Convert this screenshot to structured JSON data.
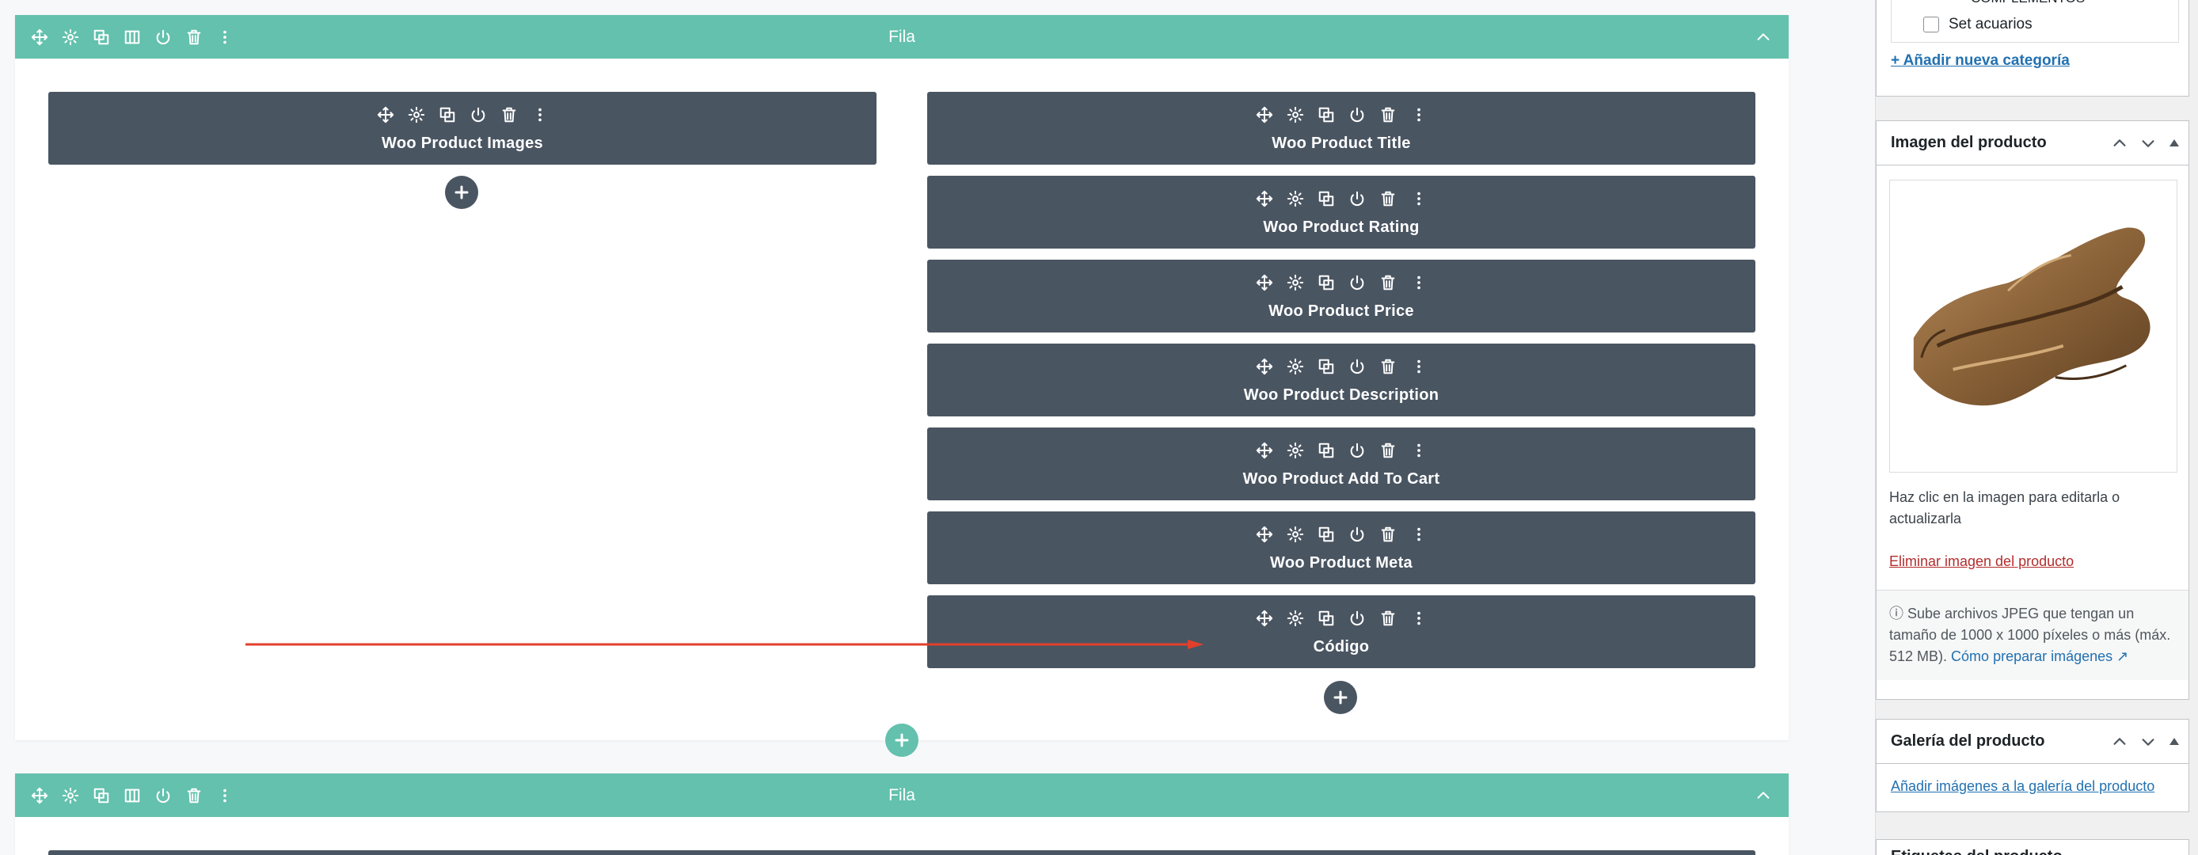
{
  "rows": [
    {
      "title": "Fila"
    },
    {
      "title": "Fila"
    }
  ],
  "left_column": {
    "modules": [
      {
        "title": "Woo Product Images"
      }
    ]
  },
  "right_column": {
    "modules": [
      {
        "title": "Woo Product Title"
      },
      {
        "title": "Woo Product Rating"
      },
      {
        "title": "Woo Product Price"
      },
      {
        "title": "Woo Product Description"
      },
      {
        "title": "Woo Product Add To Cart"
      },
      {
        "title": "Woo Product Meta"
      },
      {
        "title": "Código"
      }
    ]
  },
  "icons": {
    "row_tools": [
      "move-icon",
      "gear-icon",
      "duplicate-icon",
      "columns-icon",
      "power-icon",
      "trash-icon",
      "more-icon"
    ],
    "module_tools": [
      "move-icon",
      "gear-icon",
      "duplicate-icon",
      "power-icon",
      "trash-icon",
      "more-icon"
    ]
  },
  "colors": {
    "row_header": "#63c1ad",
    "module_bg": "#4a5562",
    "annotation_arrow": "#e2402c",
    "link": "#2271b1",
    "danger_link": "#b32d2e"
  },
  "sidebar": {
    "categories": {
      "cut_label": "COMPLEMENTOS",
      "item_label": "Set acuarios",
      "item_checked": false,
      "add_link": "+ Añadir nueva categoría"
    },
    "product_image": {
      "title": "Imagen del producto",
      "help": "Haz clic en la imagen para editarla o actualizarla",
      "remove_link": "Eliminar imagen del producto",
      "notice": "Sube archivos JPEG que tengan un tamaño de 1000 x 1000 píxeles o más (máx. 512 MB).",
      "notice_link": "Cómo preparar imágenes"
    },
    "gallery": {
      "title": "Galería del producto",
      "link": "Añadir imágenes a la galería del producto"
    },
    "tags": {
      "title": "Etiquetas del producto"
    }
  }
}
